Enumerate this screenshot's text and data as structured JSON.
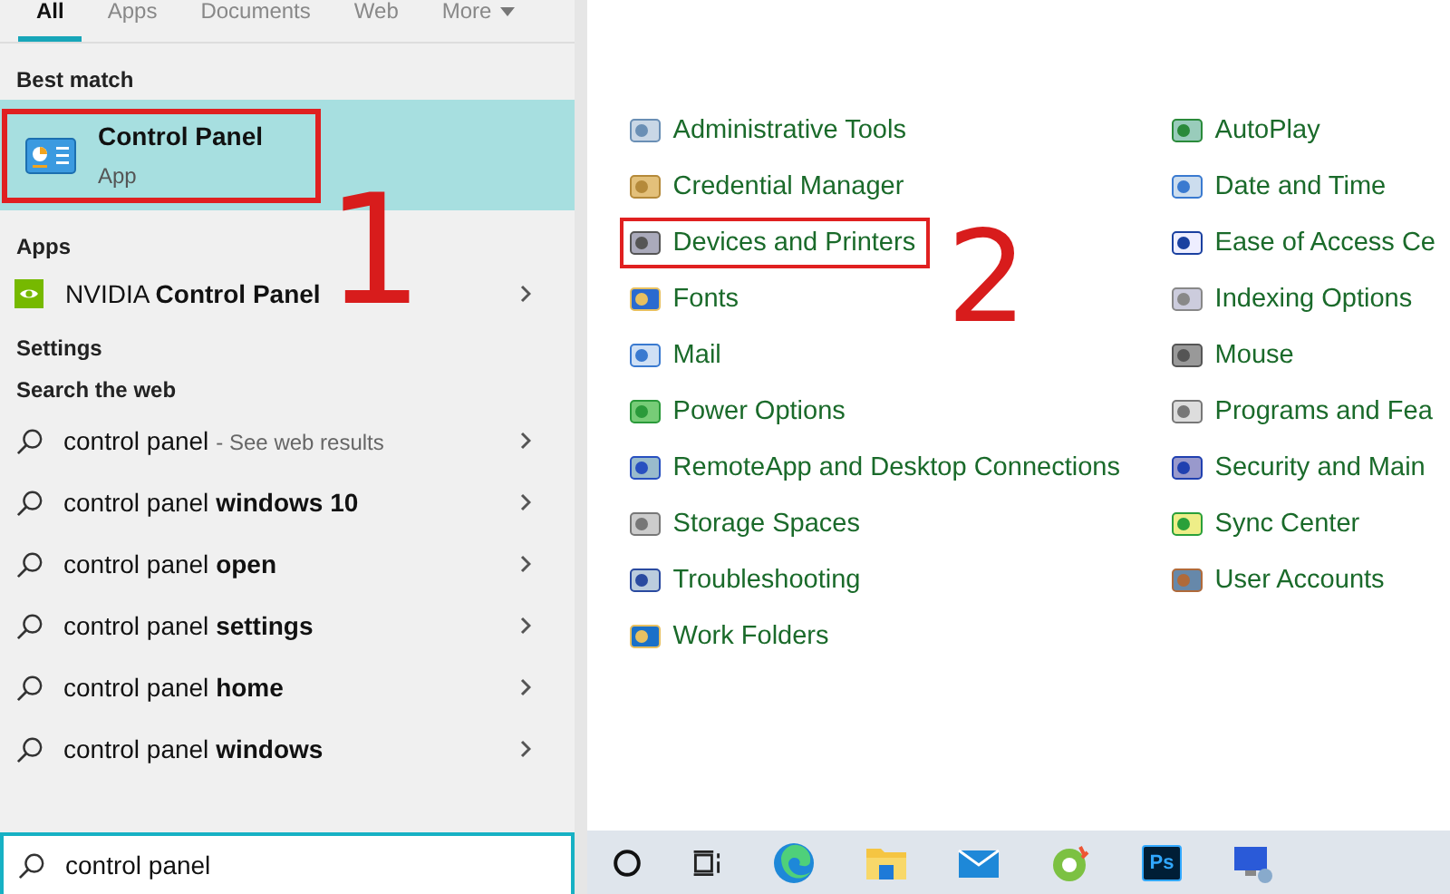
{
  "tabs": [
    {
      "label": "All",
      "selected": true
    },
    {
      "label": "Apps",
      "selected": false
    },
    {
      "label": "Documents",
      "selected": false
    },
    {
      "label": "Web",
      "selected": false
    },
    {
      "label": "More",
      "selected": false,
      "dropdown": true
    }
  ],
  "best_match": {
    "heading": "Best match",
    "title": "Control Panel",
    "subtitle": "App",
    "selected": true,
    "highlighted": true,
    "annotation": "1"
  },
  "apps": {
    "heading": "Apps",
    "items": [
      {
        "text": "NVIDIA **Control Panel**"
      }
    ]
  },
  "settings": {
    "heading": "Settings"
  },
  "web": {
    "heading": "Search the web",
    "items": [
      {
        "text": "control panel",
        "note": "- See web results"
      },
      {
        "text": "control panel **windows 10**"
      },
      {
        "text": "control panel **open**"
      },
      {
        "text": "control panel **settings**"
      },
      {
        "text": "control panel **home**"
      },
      {
        "text": "control panel **windows**"
      }
    ]
  },
  "search": {
    "value": "control panel"
  },
  "control_panel": {
    "columns": [
      [
        {
          "label": "Administrative Tools",
          "highlighted": false
        },
        {
          "label": "Credential Manager",
          "highlighted": false
        },
        {
          "label": "Devices and Printers",
          "highlighted": true,
          "annotation": "2"
        },
        {
          "label": "Fonts",
          "highlighted": false
        },
        {
          "label": "Mail",
          "highlighted": false
        },
        {
          "label": "Power Options",
          "highlighted": false
        },
        {
          "label": "RemoteApp and Desktop Connections",
          "highlighted": false
        },
        {
          "label": "Storage Spaces",
          "highlighted": false
        },
        {
          "label": "Troubleshooting",
          "highlighted": false
        },
        {
          "label": "Work Folders",
          "highlighted": false
        }
      ],
      [
        {
          "label": "AutoPlay",
          "highlighted": false
        },
        {
          "label": "Date and Time",
          "highlighted": false
        },
        {
          "label": "Ease of Access Ce",
          "highlighted": false
        },
        {
          "label": "Indexing Options",
          "highlighted": false
        },
        {
          "label": "Mouse",
          "highlighted": false
        },
        {
          "label": "Programs and Fea",
          "highlighted": false
        },
        {
          "label": "Security and Main",
          "highlighted": false
        },
        {
          "label": "Sync Center",
          "highlighted": false
        },
        {
          "label": "User Accounts",
          "highlighted": false
        }
      ]
    ]
  },
  "taskbar": [
    {
      "kind": "cortana"
    },
    {
      "kind": "taskview"
    },
    {
      "kind": "edge"
    },
    {
      "kind": "explorer"
    },
    {
      "kind": "mail"
    },
    {
      "kind": "coccoc"
    },
    {
      "kind": "badge",
      "label": "Ps"
    },
    {
      "kind": "network"
    }
  ]
}
